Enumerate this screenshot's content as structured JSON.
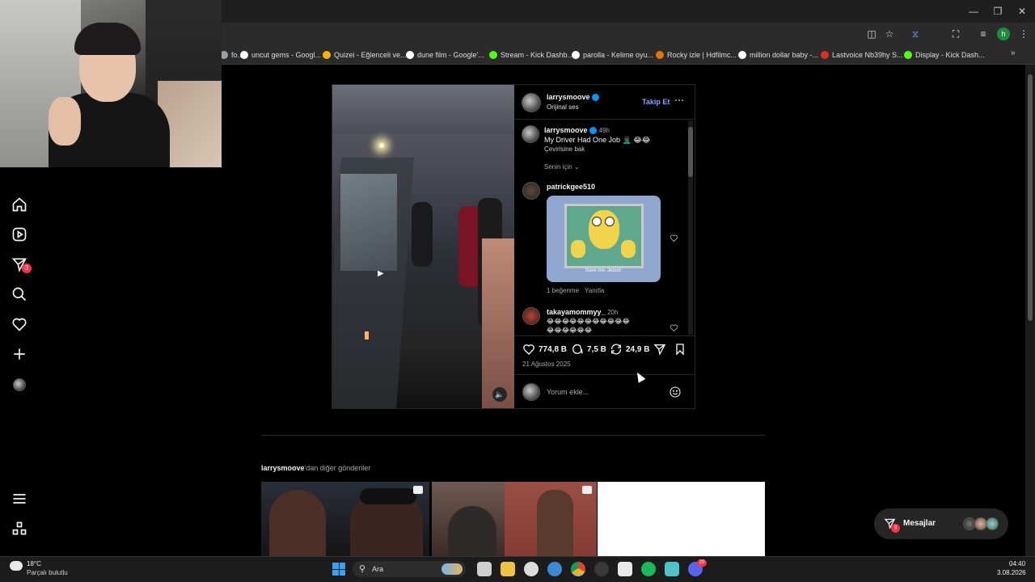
{
  "browser": {
    "address_partial": "",
    "bookmarks": [
      {
        "label": "fo...",
        "color": "#9aa0a6"
      },
      {
        "label": "uncut gems - Googl...",
        "color": "#ffffff"
      },
      {
        "label": "Quizei - Eğlenceli ve...",
        "color": "#f4b400"
      },
      {
        "label": "dune film - Google'...",
        "color": "#ffffff"
      },
      {
        "label": "Stream - Kick Dashb...",
        "color": "#53fc18"
      },
      {
        "label": "parolla - Kelime oyu...",
        "color": "#ffffff"
      },
      {
        "label": "Rocky izle | Hdfilmc...",
        "color": "#e8710a"
      },
      {
        "label": "million dollar baby -...",
        "color": "#ffffff"
      },
      {
        "label": "Lastvoice Nb39hy S...",
        "color": "#d93025"
      },
      {
        "label": "Display - Kick Dash...",
        "color": "#53fc18"
      }
    ]
  },
  "post": {
    "author": "larrysmoove",
    "audio": "Orijinal ses",
    "follow_label": "Takip Et",
    "caption_author": "larrysmoove",
    "caption_time": "49h",
    "caption_text": "My Driver Had One Job 🤦🏿‍♂️ 😂😂",
    "translate_label": "Çevirisine bak",
    "sort_label": "Senin için",
    "comments": [
      {
        "user": "patrickgee510",
        "time": "",
        "likes_label": "1 beğenme",
        "reply_label": "Yanıtla",
        "gif_caption": "Save me, Jebus!"
      },
      {
        "user": "takayamommyy_",
        "time": "20h",
        "text_line1": "😂😂😂😂😂😂😂😂😂😂😂",
        "text_line2": "😂😂😂😂😂😂"
      }
    ],
    "likes": "774,8 B",
    "comments_count": "7,5 B",
    "reposts": "24,9 B",
    "date": "21 Ağustos 2025",
    "comment_placeholder": "Yorum ekle..."
  },
  "more_posts": {
    "author": "larrysmoove",
    "suffix": "'dan diğer gönderiler"
  },
  "messages": {
    "label": "Mesajlar",
    "badge": "3"
  },
  "nav": {
    "messages_badge": "3"
  },
  "taskbar": {
    "temp": "18°C",
    "weather": "Parçalı bulutlu",
    "search": "Ara",
    "time": "04:40",
    "date": "3.08.2026",
    "discord_badge": "29"
  },
  "colors": {
    "accent": "#0095f6",
    "follow": "#8aa4ff",
    "badge": "#ff3040"
  }
}
